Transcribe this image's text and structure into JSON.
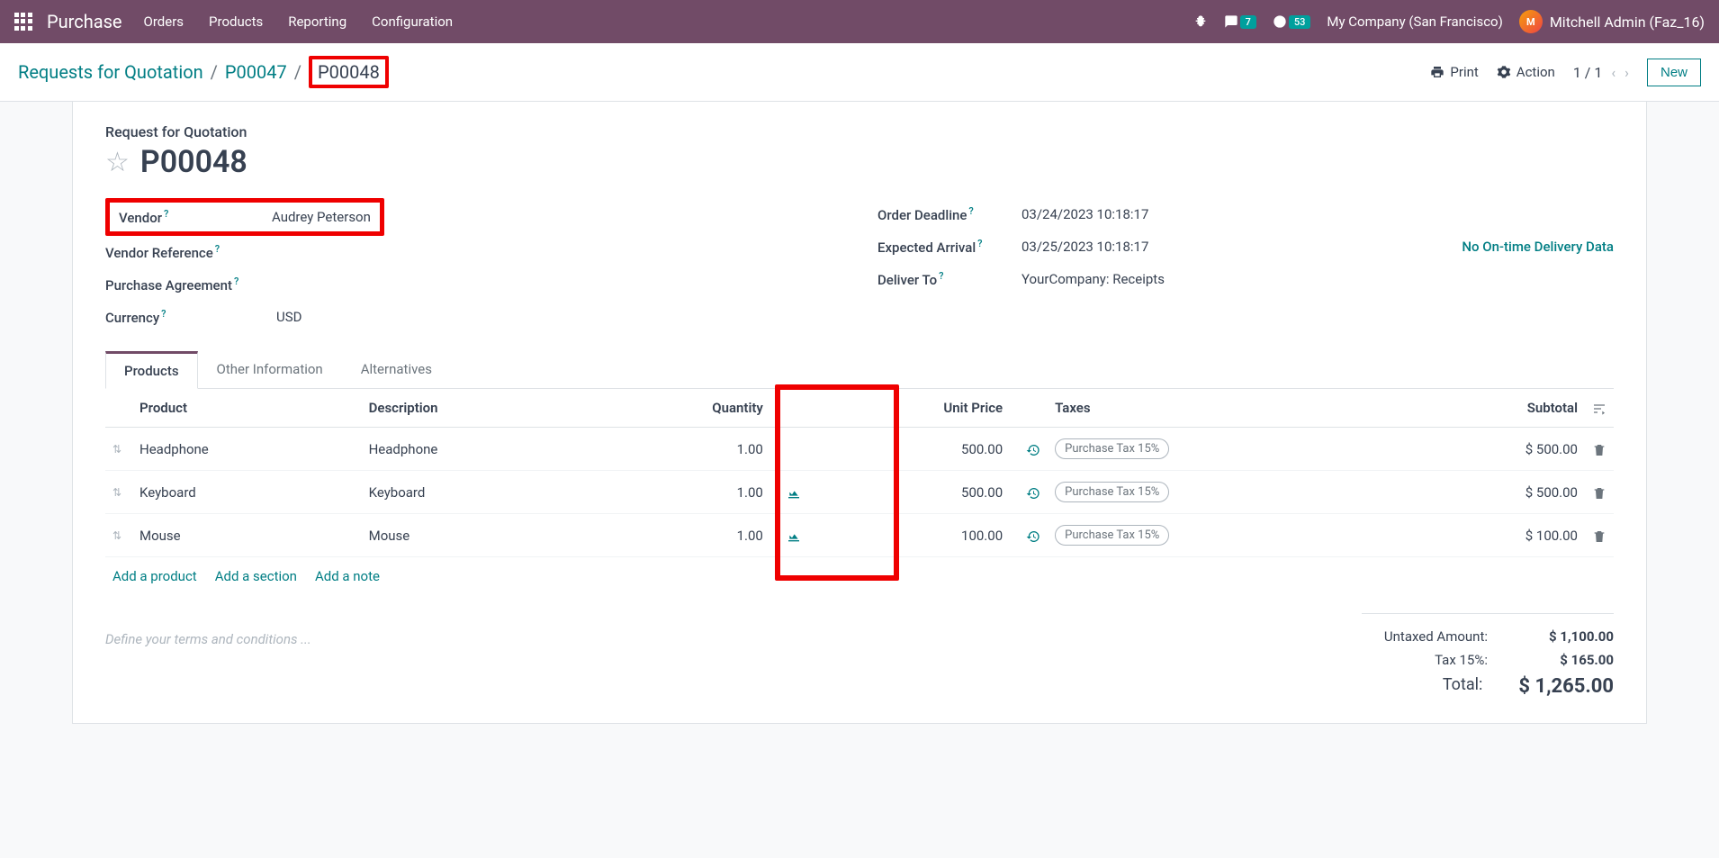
{
  "topbar": {
    "brand": "Purchase",
    "nav": [
      "Orders",
      "Products",
      "Reporting",
      "Configuration"
    ],
    "msg_badge": "7",
    "clock_badge": "53",
    "company": "My Company (San Francisco)",
    "user": "Mitchell Admin (Faz_16)"
  },
  "control": {
    "breadcrumb": [
      "Requests for Quotation",
      "P00047",
      "P00048"
    ],
    "print": "Print",
    "action": "Action",
    "pager": "1 / 1",
    "new": "New"
  },
  "form": {
    "title_label": "Request for Quotation",
    "title": "P00048",
    "vendor_label": "Vendor",
    "vendor": "Audrey Peterson",
    "vendor_ref_label": "Vendor Reference",
    "agreement_label": "Purchase Agreement",
    "currency_label": "Currency",
    "currency": "USD",
    "deadline_label": "Order Deadline",
    "deadline": "03/24/2023 10:18:17",
    "arrival_label": "Expected Arrival",
    "arrival": "03/25/2023 10:18:17",
    "delivery_stat": "No On-time Delivery Data",
    "deliver_to_label": "Deliver To",
    "deliver_to": "YourCompany: Receipts"
  },
  "tabs": [
    "Products",
    "Other Information",
    "Alternatives"
  ],
  "columns": {
    "product": "Product",
    "description": "Description",
    "quantity": "Quantity",
    "unit_price": "Unit Price",
    "taxes": "Taxes",
    "subtotal": "Subtotal"
  },
  "lines": [
    {
      "product": "Headphone",
      "description": "Headphone",
      "qty": "1.00",
      "price": "500.00",
      "tax": "Purchase Tax 15%",
      "subtotal": "$ 500.00",
      "forecast": false
    },
    {
      "product": "Keyboard",
      "description": "Keyboard",
      "qty": "1.00",
      "price": "500.00",
      "tax": "Purchase Tax 15%",
      "subtotal": "$ 500.00",
      "forecast": true
    },
    {
      "product": "Mouse",
      "description": "Mouse",
      "qty": "1.00",
      "price": "100.00",
      "tax": "Purchase Tax 15%",
      "subtotal": "$ 100.00",
      "forecast": true
    }
  ],
  "add": {
    "product": "Add a product",
    "section": "Add a section",
    "note": "Add a note"
  },
  "terms_placeholder": "Define your terms and conditions ...",
  "totals": {
    "untaxed_label": "Untaxed Amount:",
    "untaxed": "$ 1,100.00",
    "tax_label": "Tax 15%:",
    "tax": "$ 165.00",
    "total_label": "Total:",
    "total": "$ 1,265.00"
  }
}
